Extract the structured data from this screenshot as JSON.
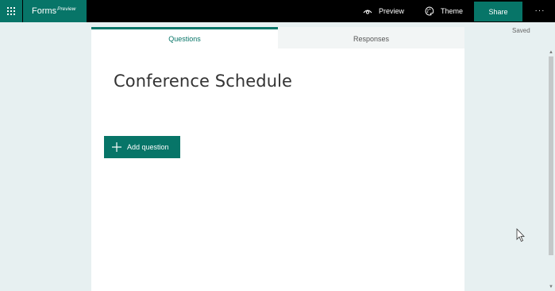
{
  "topbar": {
    "app_name": "Forms",
    "app_badge": "Preview",
    "preview_label": "Preview",
    "theme_label": "Theme",
    "share_label": "Share",
    "more_label": "···"
  },
  "status": {
    "saved": "Saved"
  },
  "tabs": [
    {
      "label": "Questions",
      "active": true
    },
    {
      "label": "Responses",
      "active": false
    }
  ],
  "form": {
    "title": "Conference Schedule",
    "add_question_label": "Add question"
  },
  "icons": {
    "app_launcher": "waffle-icon",
    "preview": "eye-icon",
    "theme": "palette-icon",
    "add": "plus-icon",
    "cursor": "mouse-pointer-icon"
  },
  "colors": {
    "accent": "#077568",
    "topbar": "#000000",
    "page_bg": "#e7f0f1",
    "card_bg": "#ffffff"
  }
}
